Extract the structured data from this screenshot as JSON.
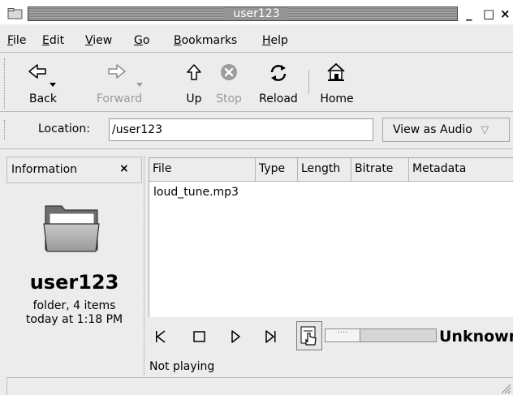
{
  "window": {
    "title": "user123",
    "controls": {
      "minimize": "_",
      "maximize": "□",
      "close": "×"
    }
  },
  "menubar": {
    "items": [
      {
        "label": "File",
        "mnemonic": "F",
        "rest": "ile"
      },
      {
        "label": "Edit",
        "mnemonic": "E",
        "rest": "dit"
      },
      {
        "label": "View",
        "mnemonic": "V",
        "rest": "iew"
      },
      {
        "label": "Go",
        "mnemonic": "G",
        "rest": "o"
      },
      {
        "label": "Bookmarks",
        "mnemonic": "B",
        "rest": "ookmarks"
      },
      {
        "label": "Help",
        "mnemonic": "H",
        "rest": "elp"
      }
    ]
  },
  "toolbar": {
    "back": "Back",
    "forward": "Forward",
    "up": "Up",
    "stop": "Stop",
    "reload": "Reload",
    "home": "Home"
  },
  "location": {
    "label": "Location:",
    "value": "/user123",
    "view_as": "View as Audio",
    "view_as_arrow": "▽"
  },
  "side_pane": {
    "title": "Information",
    "close": "×",
    "folder_name": "user123",
    "folder_info": "folder, 4 items",
    "folder_date": "today at 1:18 PM"
  },
  "file_list": {
    "columns": [
      "File",
      "Type",
      "Length",
      "Bitrate",
      "Metadata"
    ],
    "rows": [
      {
        "file": "loud_tune.mp3",
        "type": "",
        "length": "",
        "bitrate": "",
        "metadata": ""
      }
    ]
  },
  "player": {
    "track": "Unknown",
    "status": "Not playing",
    "seek_knob": "····"
  }
}
